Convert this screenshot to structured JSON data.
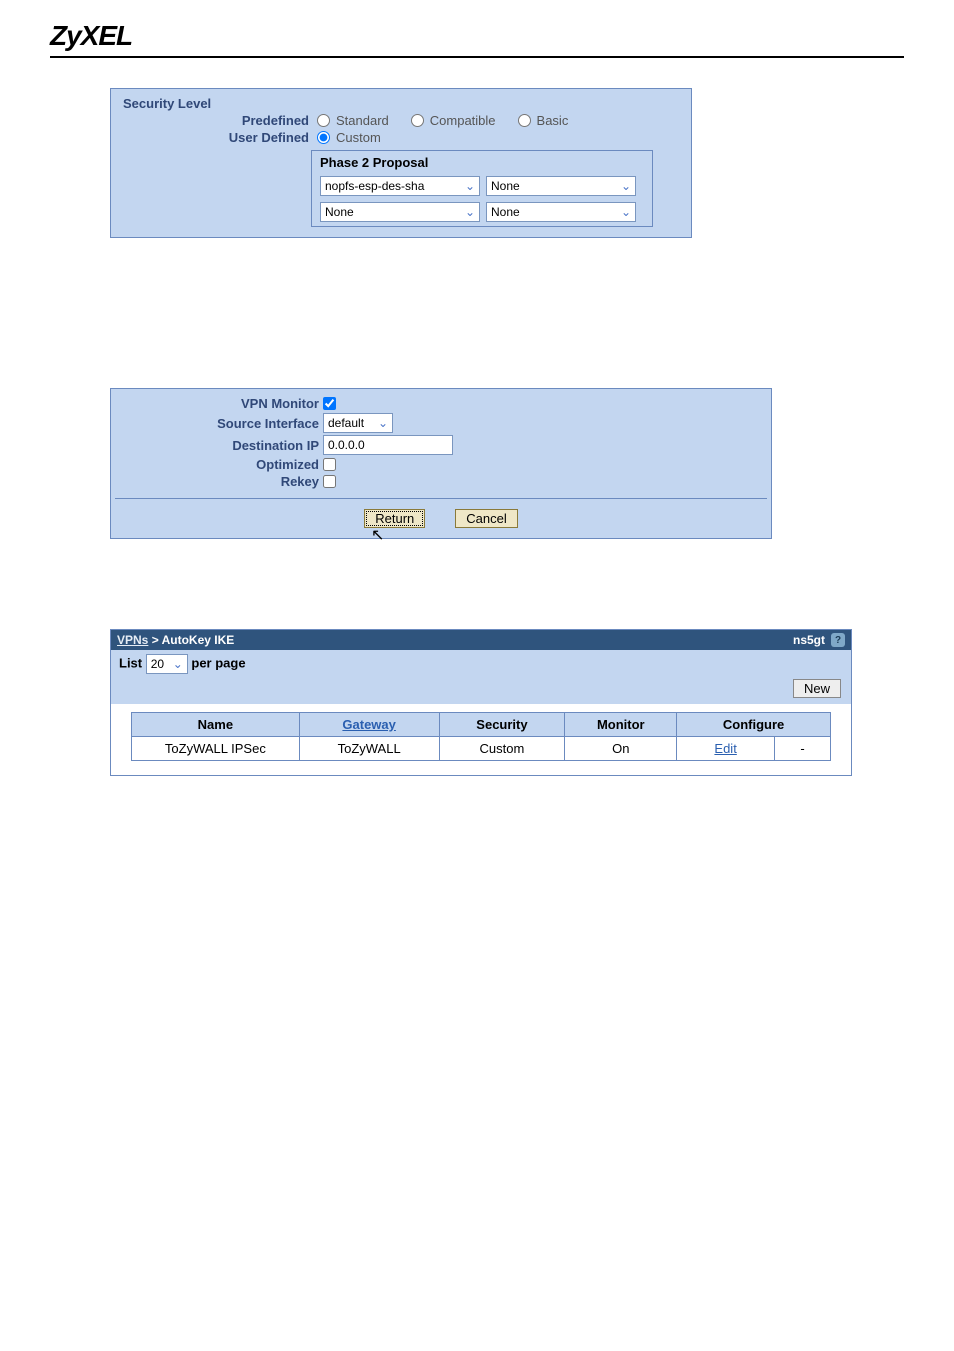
{
  "header": {
    "logo": "ZyXEL"
  },
  "security_panel": {
    "title": "Security Level",
    "predefined_label": "Predefined",
    "user_defined_label": "User Defined",
    "opts": {
      "standard": "Standard",
      "compatible": "Compatible",
      "basic": "Basic",
      "custom": "Custom"
    },
    "phase2_title": "Phase 2 Proposal",
    "selects": {
      "a1": "nopfs-esp-des-sha",
      "a2": "None",
      "b1": "None",
      "b2": "None"
    }
  },
  "vpn_panel": {
    "vpn_monitor_label": "VPN Monitor",
    "source_iface_label": "Source Interface",
    "source_iface_value": "default",
    "dest_ip_label": "Destination IP",
    "dest_ip_value": "0.0.0.0",
    "optimized_label": "Optimized",
    "rekey_label": "Rekey",
    "return_btn": "Return",
    "cancel_btn": "Cancel"
  },
  "list_panel": {
    "breadcrumb_root": "VPNs",
    "breadcrumb_leaf": "AutoKey IKE",
    "device": "ns5gt",
    "list_label": "List",
    "per_page_value": "20",
    "per_page_label": "per page",
    "new_btn": "New",
    "columns": {
      "name": "Name",
      "gateway": "Gateway",
      "security": "Security",
      "monitor": "Monitor",
      "configure": "Configure"
    },
    "row": {
      "name": "ToZyWALL IPSec",
      "gateway": "ToZyWALL",
      "security": "Custom",
      "monitor": "On",
      "edit": "Edit",
      "remove": "-"
    }
  }
}
